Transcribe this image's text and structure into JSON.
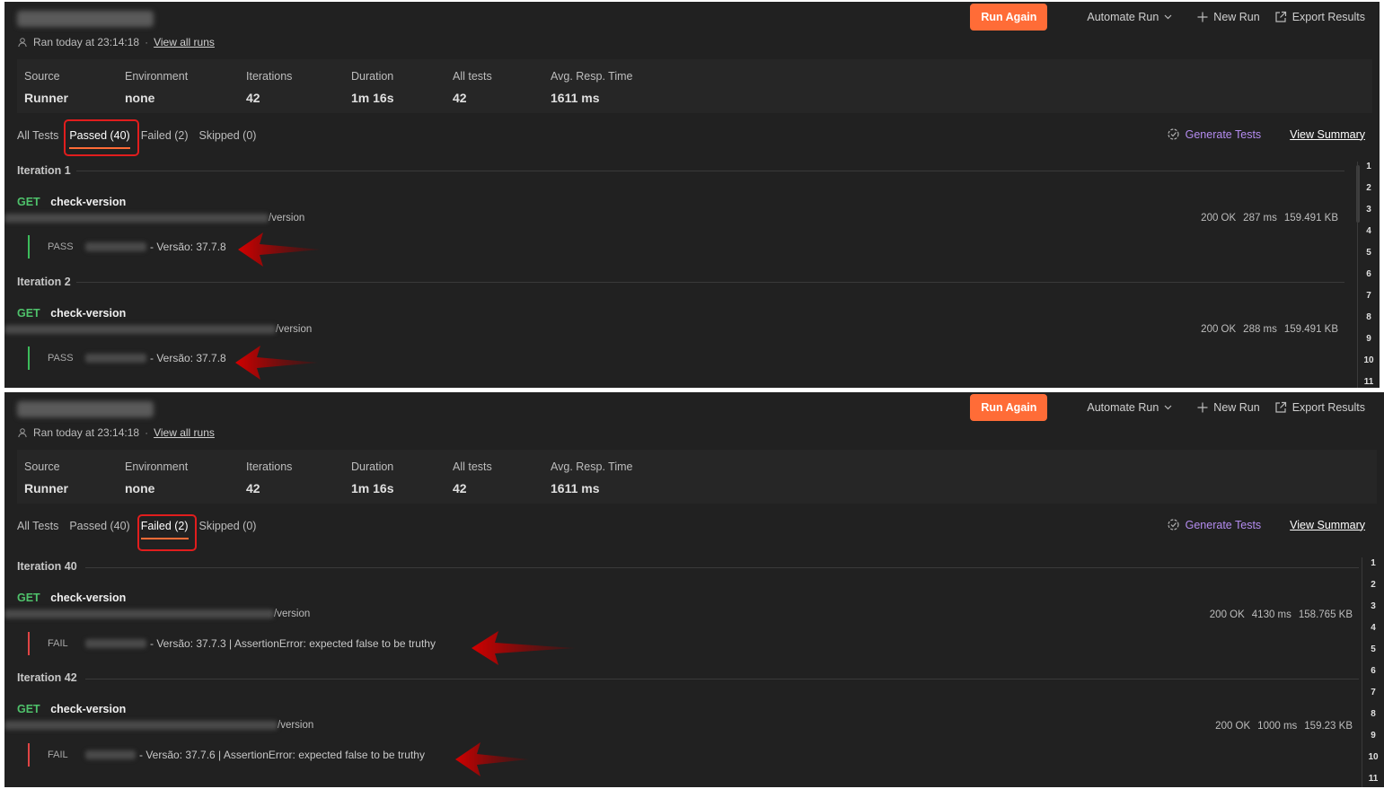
{
  "header": {
    "ran_text": "Ran today at 23:14:18",
    "separator": "·",
    "view_all_runs": "View all runs"
  },
  "actions": {
    "run_again": "Run Again",
    "automate_run": "Automate Run",
    "new_run": "New Run",
    "export_results": "Export Results"
  },
  "stats": [
    {
      "label": "Source",
      "value": "Runner"
    },
    {
      "label": "Environment",
      "value": "none"
    },
    {
      "label": "Iterations",
      "value": "42"
    },
    {
      "label": "Duration",
      "value": "1m 16s"
    },
    {
      "label": "All tests",
      "value": "42"
    },
    {
      "label": "Avg. Resp. Time",
      "value": "1611 ms"
    }
  ],
  "tabs": {
    "all": "All Tests",
    "passed": "Passed (40)",
    "failed": "Failed (2)",
    "skipped": "Skipped (0)"
  },
  "links": {
    "generate_tests": "Generate Tests",
    "view_summary": "View Summary"
  },
  "panel1": {
    "active_tab": "passed",
    "iterations": [
      {
        "title": "Iteration 1",
        "method": "GET",
        "name": "check-version",
        "url_suffix": "/version",
        "status": "200 OK",
        "time": "287 ms",
        "size": "159.491 KB",
        "result_status": "PASS",
        "result_text": "- Versão: 37.7.8"
      },
      {
        "title": "Iteration 2",
        "method": "GET",
        "name": "check-version",
        "url_suffix": "/version",
        "status": "200 OK",
        "time": "288 ms",
        "size": "159.491 KB",
        "result_status": "PASS",
        "result_text": "- Versão: 37.7.8"
      }
    ],
    "scroll_numbers": [
      "1",
      "2",
      "3",
      "4",
      "5",
      "6",
      "7",
      "8",
      "9",
      "10",
      "11"
    ]
  },
  "panel2": {
    "active_tab": "failed",
    "iterations": [
      {
        "title": "Iteration 40",
        "method": "GET",
        "name": "check-version",
        "url_suffix": "/version",
        "status": "200 OK",
        "time": "4130 ms",
        "size": "158.765 KB",
        "result_status": "FAIL",
        "result_text": "- Versão: 37.7.3 | AssertionError: expected false to be truthy"
      },
      {
        "title": "Iteration 42",
        "method": "GET",
        "name": "check-version",
        "url_suffix": "/version",
        "status": "200 OK",
        "time": "1000 ms",
        "size": "159.23 KB",
        "result_status": "FAIL",
        "result_text": "- Versão: 37.7.6 | AssertionError: expected false to be truthy"
      }
    ],
    "scroll_numbers": [
      "1",
      "2",
      "3",
      "4",
      "5",
      "6",
      "7",
      "8",
      "9",
      "10",
      "11"
    ]
  },
  "colors": {
    "accent": "#ff6c37",
    "pass": "#3cbc5b",
    "fail": "#e04444",
    "highlight_box": "#e11d1d",
    "generate": "#b48cf0"
  }
}
